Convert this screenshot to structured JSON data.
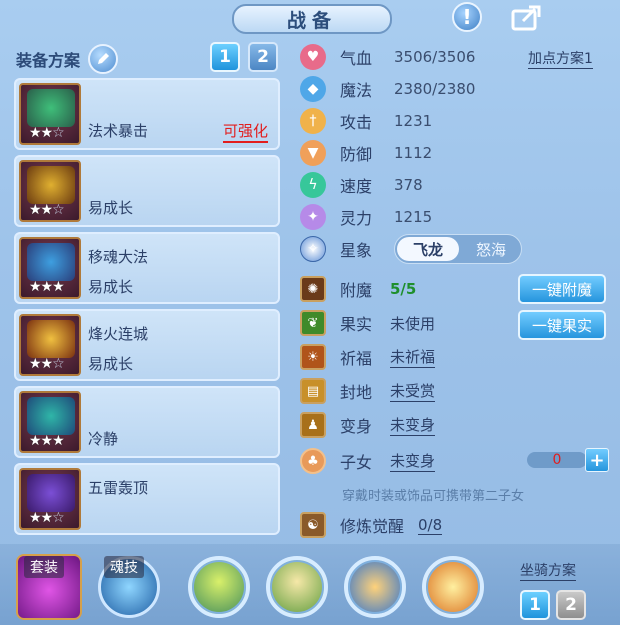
{
  "title": "战备",
  "equip_plan": {
    "label": "装备方案",
    "schemes": [
      "1",
      "2"
    ]
  },
  "equipment": [
    {
      "name": "法术暴击",
      "stars": 2,
      "max_stars": 3,
      "tag": "可强化",
      "art": "#3fbf7a"
    },
    {
      "name": "易成长",
      "stars": 2,
      "max_stars": 3,
      "tag": "",
      "art": "#d6a12c"
    },
    {
      "name": "移魂大法",
      "sub": "易成长",
      "stars": 3,
      "max_stars": 3,
      "tag": "",
      "art": "#3e9fe0"
    },
    {
      "name": "烽火连城",
      "sub": "易成长",
      "stars": 2,
      "max_stars": 3,
      "tag": "",
      "art": "#e0b030"
    },
    {
      "name": "冷静",
      "stars": 3,
      "max_stars": 3,
      "tag": "",
      "art": "#2fb6a8"
    },
    {
      "name": "五雷轰顶",
      "stars": 2,
      "max_stars": 3,
      "tag": "",
      "art": "#7b4fd6"
    }
  ],
  "attributes": [
    {
      "name": "气血",
      "value": "3506/3506",
      "icon": "heart-icon",
      "color": "#e86b8a"
    },
    {
      "name": "魔法",
      "value": "2380/2380",
      "icon": "mana-icon",
      "color": "#4fa7e8"
    },
    {
      "name": "攻击",
      "value": "1231",
      "icon": "sword-icon",
      "color": "#f0b24a"
    },
    {
      "name": "防御",
      "value": "1112",
      "icon": "shield-icon",
      "color": "#f0a05a"
    },
    {
      "name": "速度",
      "value": "378",
      "icon": "lightning-icon",
      "color": "#37c79a"
    },
    {
      "name": "灵力",
      "value": "1215",
      "icon": "spirit-icon",
      "color": "#b68ae8"
    }
  ],
  "point_plan": "加点方案1",
  "star_sign": {
    "label": "星象",
    "options": [
      "飞龙",
      "怒海"
    ],
    "selected": "飞龙"
  },
  "functions": [
    {
      "name": "附魔",
      "value": "5/5",
      "style": "green",
      "button": "一键附魔"
    },
    {
      "name": "果实",
      "value": "未使用",
      "style": "plain",
      "button": "一键果实"
    },
    {
      "name": "祈福",
      "value": "未祈福",
      "style": "link",
      "button": ""
    },
    {
      "name": "封地",
      "value": "未受赏",
      "style": "link",
      "button": ""
    },
    {
      "name": "变身",
      "value": "未变身",
      "style": "link",
      "button": ""
    },
    {
      "name": "子女",
      "value": "未变身",
      "style": "link",
      "button": ""
    }
  ],
  "child_counter": "0",
  "child_hint": "穿戴时装或饰品可携带第二子女",
  "cultivation": {
    "name": "修炼觉醒",
    "value": "0/8"
  },
  "bottom": {
    "set_label": "套装",
    "soul_label": "魂技",
    "mount_plan": "坐骑方案",
    "mount_schemes": [
      "1",
      "2"
    ]
  }
}
